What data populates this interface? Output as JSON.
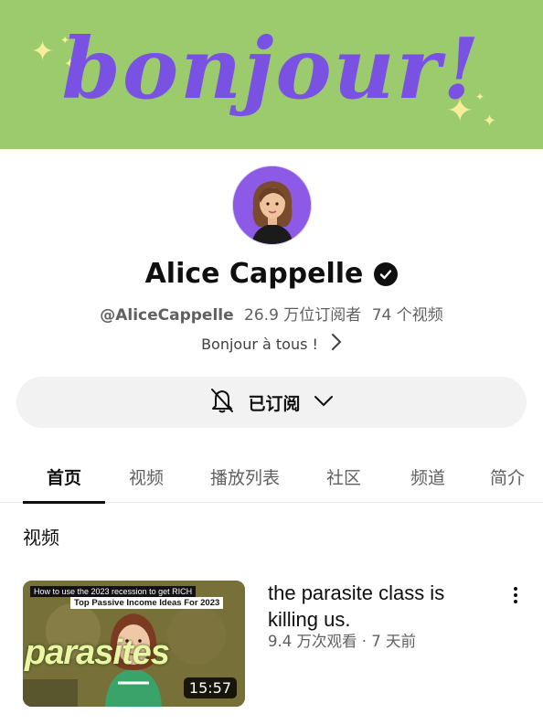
{
  "banner": {
    "text": "bonjour!",
    "colors": {
      "background": "#9ccb6e",
      "text": "#7a52e3",
      "sparkle": "#f6ee9d"
    }
  },
  "channel": {
    "name": "Alice Cappelle",
    "verified_icon": "verified-check-icon",
    "handle": "@AliceCappelle",
    "subscribers": "26.9 万位订阅者",
    "video_count": "74 个视频",
    "description": "Bonjour à tous !"
  },
  "subscribe": {
    "label": "已订阅",
    "bell_icon": "bell-off-icon",
    "chevron_icon": "chevron-down-icon"
  },
  "tabs": [
    {
      "label": "首页",
      "active": true
    },
    {
      "label": "视频",
      "active": false
    },
    {
      "label": "播放列表",
      "active": false
    },
    {
      "label": "社区",
      "active": false
    },
    {
      "label": "频道",
      "active": false
    },
    {
      "label": "简介",
      "active": false
    }
  ],
  "section": {
    "title": "视频"
  },
  "videos": [
    {
      "title": "the parasite class is killing us.",
      "meta": "9.4 万次观看 · 7 天前",
      "duration": "15:57",
      "thumbnail": {
        "caption_top": "How to use the 2023 recession to get RICH",
        "caption_sub": "Top Passive Income Ideas For 2023",
        "big_text": "parasites"
      }
    }
  ]
}
